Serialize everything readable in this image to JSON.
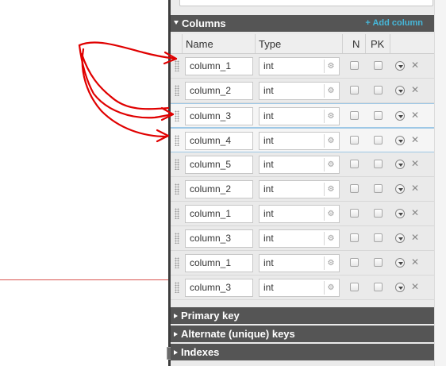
{
  "columns_section": {
    "title": "Columns",
    "add_label": "+ Add column",
    "headers": {
      "name": "Name",
      "type": "Type",
      "nullable": "N",
      "primary_key": "PK"
    },
    "rows": [
      {
        "name": "column_1",
        "type": "int"
      },
      {
        "name": "column_2",
        "type": "int"
      },
      {
        "name": "column_3",
        "type": "int"
      },
      {
        "name": "column_4",
        "type": "int"
      },
      {
        "name": "column_5",
        "type": "int"
      },
      {
        "name": "column_2",
        "type": "int"
      },
      {
        "name": "column_1",
        "type": "int"
      },
      {
        "name": "column_3",
        "type": "int"
      },
      {
        "name": "column_1",
        "type": "int"
      },
      {
        "name": "column_3",
        "type": "int"
      }
    ]
  },
  "sections": {
    "primary_key": "Primary key",
    "alternate_keys": "Alternate (unique) keys",
    "indexes": "Indexes"
  },
  "colors": {
    "section_header": "#555555",
    "add_column_link": "#46b8da",
    "annotation": "#e00000"
  }
}
